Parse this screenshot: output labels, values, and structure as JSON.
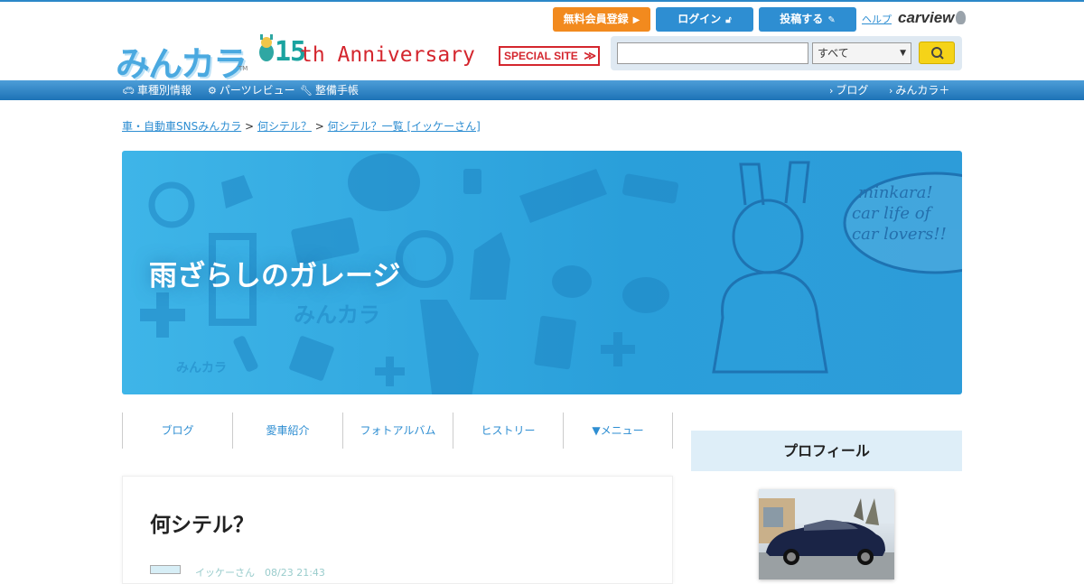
{
  "header": {
    "logo_text": "みんカラ",
    "logo_tm": "TM",
    "anniversary": {
      "number": "15",
      "text": "th Anniversary",
      "special_site_label": "SPECIAL SITE",
      "special_site_arrow": "≫"
    },
    "register_label": "無料会員登録",
    "login_label": "ログイン",
    "post_label": "投稿する",
    "help_label": "ヘルプ",
    "carview_label": "carview",
    "carview_tm": "TM",
    "search": {
      "value": "",
      "placeholder": "",
      "select_value": "すべて"
    }
  },
  "navbar": {
    "items": [
      {
        "label": "車種別情報",
        "icon": "car-icon"
      },
      {
        "label": "パーツレビュー",
        "icon": "parts-icon"
      },
      {
        "label": "整備手帳",
        "icon": "wrench-icon"
      }
    ],
    "right_items": [
      {
        "label": "ブログ"
      },
      {
        "label": "みんカラ＋"
      }
    ]
  },
  "breadcrumb": {
    "items": [
      "車・自動車SNSみんカラ",
      "何シテル？",
      "何シテル？一覧 [イッケーさん]"
    ],
    "separator": ">"
  },
  "banner": {
    "title": "雨ざらしのガレージ",
    "bubble_text": [
      "minkara!",
      "car life of",
      "car lovers!!"
    ],
    "bg_color": "#2a9fda"
  },
  "tabs": [
    {
      "label": "ブログ"
    },
    {
      "label": "愛車紹介"
    },
    {
      "label": "フォトアルバム"
    },
    {
      "label": "ヒストリー"
    },
    {
      "label": "▼メニュー"
    }
  ],
  "main": {
    "title": "何シテル？",
    "partial_row_text": "イッケーさん　08/23 21:43"
  },
  "sidebar": {
    "profile_heading": "プロフィール"
  },
  "colors": {
    "accent": "#2e8ed2",
    "orange": "#f28a1e",
    "nav": "#1d72b6"
  }
}
